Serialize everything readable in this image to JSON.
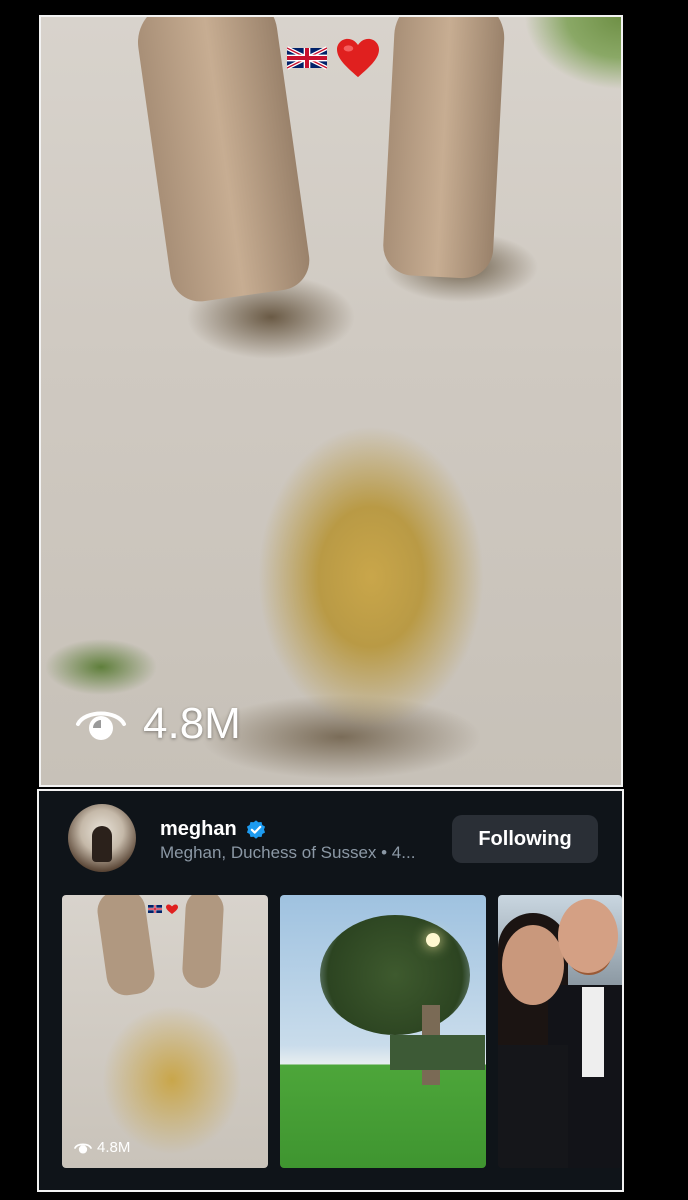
{
  "video": {
    "overlay_emojis": [
      "flag-uk-icon",
      "red-heart-icon"
    ],
    "view_count": "4.8M"
  },
  "profile": {
    "username": "meghan",
    "verified": true,
    "display_name": "Meghan, Duchess of Sussex • 4...",
    "follow_button_label": "Following"
  },
  "thumbnails": [
    {
      "view_count": "4.8M"
    },
    {},
    {}
  ],
  "colors": {
    "card_background": "#0f1419",
    "verified_blue": "#1d9bf0",
    "button_background": "#2a2f36",
    "secondary_text": "#8b98a5"
  }
}
